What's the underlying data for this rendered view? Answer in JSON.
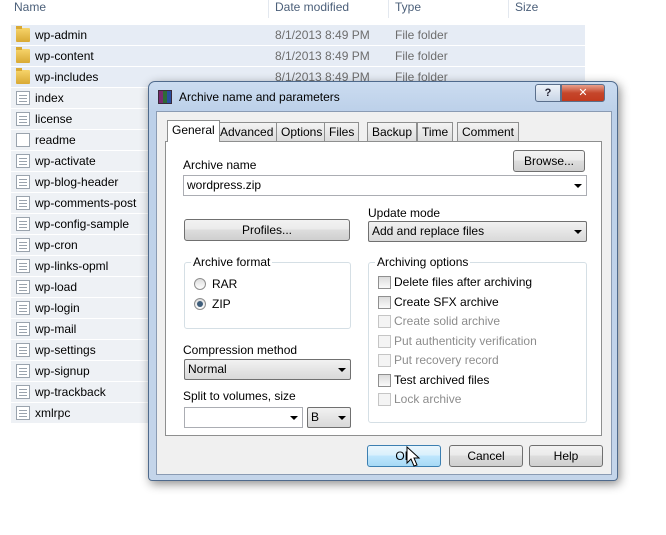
{
  "explorer": {
    "columns": {
      "name": "Name",
      "date": "Date modified",
      "type": "Type",
      "size": "Size"
    },
    "rows": [
      {
        "name": "wp-admin",
        "date": "8/1/2013 8:49 PM",
        "type": "File folder",
        "icon": "folder-icon"
      },
      {
        "name": "wp-content",
        "date": "8/1/2013 8:49 PM",
        "type": "File folder",
        "icon": "folder-icon"
      },
      {
        "name": "wp-includes",
        "date": "8/1/2013 8:49 PM",
        "type": "File folder",
        "icon": "folder-icon"
      },
      {
        "name": "index",
        "icon": "php-file-icon"
      },
      {
        "name": "license",
        "icon": "text-file-icon"
      },
      {
        "name": "readme",
        "icon": "blank-file-icon"
      },
      {
        "name": "wp-activate",
        "icon": "php-file-icon"
      },
      {
        "name": "wp-blog-header",
        "icon": "php-file-icon"
      },
      {
        "name": "wp-comments-post",
        "icon": "php-file-icon"
      },
      {
        "name": "wp-config-sample",
        "icon": "php-file-icon"
      },
      {
        "name": "wp-cron",
        "icon": "php-file-icon"
      },
      {
        "name": "wp-links-opml",
        "icon": "php-file-icon"
      },
      {
        "name": "wp-load",
        "icon": "php-file-icon"
      },
      {
        "name": "wp-login",
        "icon": "php-file-icon"
      },
      {
        "name": "wp-mail",
        "icon": "php-file-icon"
      },
      {
        "name": "wp-settings",
        "icon": "php-file-icon"
      },
      {
        "name": "wp-signup",
        "icon": "php-file-icon"
      },
      {
        "name": "wp-trackback",
        "icon": "php-file-icon"
      },
      {
        "name": "xmlrpc",
        "icon": "php-file-icon"
      }
    ]
  },
  "dialog": {
    "title": "Archive name and parameters",
    "help_label": "?",
    "close_label": "✕",
    "tabs": [
      "General",
      "Advanced",
      "Options",
      "Files",
      "Backup",
      "Time",
      "Comment"
    ],
    "active_tab": "General",
    "archive_name_label": "Archive name",
    "archive_name_value": "wordpress.zip",
    "browse_label": "Browse...",
    "profiles_label": "Profiles...",
    "update_mode_label": "Update mode",
    "update_mode_value": "Add and replace files",
    "archive_format": {
      "title": "Archive format",
      "options": [
        {
          "label": "RAR",
          "selected": false
        },
        {
          "label": "ZIP",
          "selected": true
        }
      ]
    },
    "compression_label": "Compression method",
    "compression_value": "Normal",
    "split_label": "Split to volumes, size",
    "split_value": "",
    "split_unit": "B",
    "archiving_options": {
      "title": "Archiving options",
      "items": [
        {
          "label": "Delete files after archiving",
          "checked": false,
          "enabled": true
        },
        {
          "label": "Create SFX archive",
          "checked": false,
          "enabled": true
        },
        {
          "label": "Create solid archive",
          "checked": false,
          "enabled": false
        },
        {
          "label": "Put authenticity verification",
          "checked": false,
          "enabled": false
        },
        {
          "label": "Put recovery record",
          "checked": false,
          "enabled": false
        },
        {
          "label": "Test archived files",
          "checked": false,
          "enabled": true
        },
        {
          "label": "Lock archive",
          "checked": false,
          "enabled": false
        }
      ]
    },
    "ok_label": "OK",
    "cancel_label": "Cancel",
    "help_button_label": "Help"
  }
}
